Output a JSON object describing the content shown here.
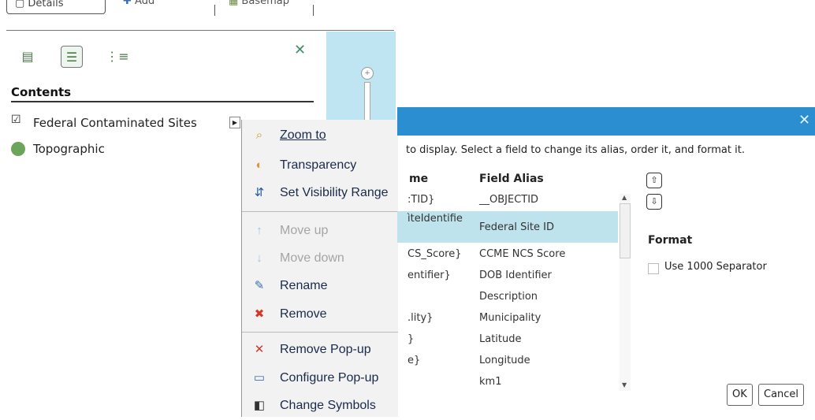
{
  "toolbar": {
    "details_label": "Details",
    "add_label": "Add",
    "basemap_label": "Basemap"
  },
  "panel": {
    "contents_title": "Contents",
    "layers": [
      {
        "label": "Federal Contaminated Sites",
        "checked": true
      },
      {
        "label": "Topographic"
      }
    ]
  },
  "context_menu": {
    "items": [
      {
        "label": "Zoom to",
        "icon": "zoom-to-icon"
      },
      {
        "label": "Transparency",
        "icon": "transparency-icon"
      },
      {
        "label": "Set Visibility Range",
        "icon": "visibility-range-icon"
      },
      {
        "label": "Move up",
        "icon": "move-up-icon",
        "disabled": true
      },
      {
        "label": "Move down",
        "icon": "move-down-icon",
        "disabled": true
      },
      {
        "label": "Rename",
        "icon": "rename-icon"
      },
      {
        "label": "Remove",
        "icon": "remove-icon"
      },
      {
        "label": "Remove Pop-up",
        "icon": "remove-popup-icon"
      },
      {
        "label": "Configure Pop-up",
        "icon": "configure-popup-icon"
      },
      {
        "label": "Change Symbols",
        "icon": "change-symbols-icon"
      }
    ]
  },
  "dialog": {
    "instruction": "to display. Select a field to change its alias, order it, and format it.",
    "col_name_header": "me",
    "col_alias_header": "Field Alias",
    "rows": [
      {
        "name": ":TID}",
        "alias": "__OBJECTID"
      },
      {
        "name": "ìteIdentifie",
        "alias": "Federal Site ID",
        "selected": true
      },
      {
        "name": "CS_Score}",
        "alias": "CCME NCS Score"
      },
      {
        "name": "entifier}",
        "alias": "DOB Identifier"
      },
      {
        "name": "",
        "alias": "Description"
      },
      {
        "name": ".lity}",
        "alias": "Municipality"
      },
      {
        "name": "}",
        "alias": "Latitude"
      },
      {
        "name": "e}",
        "alias": "Longitude"
      },
      {
        "name": "",
        "alias": "km1"
      }
    ],
    "format_title": "Format",
    "separator_label": "Use 1000 Separator",
    "ok_label": "OK",
    "cancel_label": "Cancel"
  },
  "colors": {
    "dialog_title_bar": "#2a8ed0",
    "selected_row": "#bfe3ec",
    "map_water": "#bfe4f2",
    "menu_text": "#1a2a4a"
  }
}
